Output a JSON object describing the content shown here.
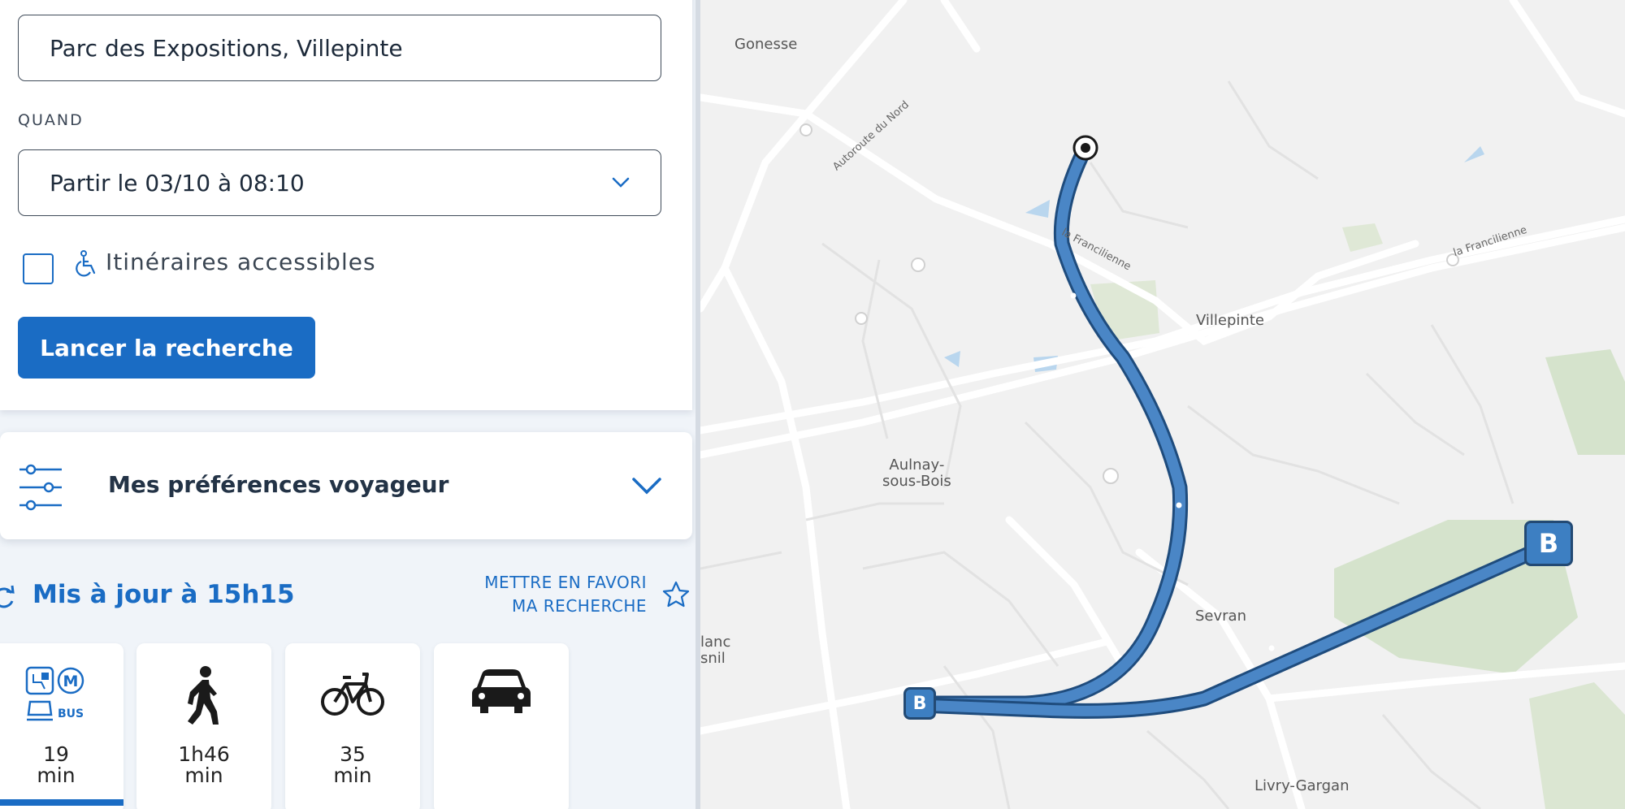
{
  "form": {
    "destination_value": "Parc des Expositions, Villepinte",
    "when_label": "QUAND",
    "when_value": "Partir le 03/10 à 08:10",
    "accessible_label": "Itinéraires accessibles",
    "search_button": "Lancer la recherche"
  },
  "preferences": {
    "label": "Mes préférences voyageur"
  },
  "results": {
    "updated_label": "Mis à jour à 15h15",
    "favorite_line1": "METTRE EN FAVORI",
    "favorite_line2": "MA RECHERCHE",
    "modes": [
      {
        "name": "transit",
        "icon": "transit-modes-icon",
        "badge_bus": "BUS",
        "badge_metro": "M",
        "duration": "19",
        "unit": "min",
        "selected": true
      },
      {
        "name": "walk",
        "icon": "pedestrian-icon",
        "duration": "1h46",
        "unit": "min"
      },
      {
        "name": "bike",
        "icon": "bicycle-icon",
        "duration": "35",
        "unit": "min"
      },
      {
        "name": "car",
        "icon": "car-icon",
        "duration": "",
        "unit": ""
      }
    ]
  },
  "map": {
    "places": {
      "gonesse": "Gonesse",
      "villepinte": "Villepinte",
      "aulnay_line1": "Aulnay-",
      "aulnay_line2": "sous-Bois",
      "sevran": "Sevran",
      "livry": "Livry-Gargan",
      "blanc_line1": "lanc",
      "blanc_line2": "snil"
    },
    "roads": {
      "autoroute": "Autoroute du Nord",
      "francilienne1": "la Francilienne",
      "francilienne2": "la Francilienne"
    },
    "markers": {
      "b_large": "B",
      "b_small": "B"
    },
    "colors": {
      "route": "#4a86c6",
      "route_outline": "#1f4c7d",
      "accent": "#1a6cc4"
    }
  }
}
